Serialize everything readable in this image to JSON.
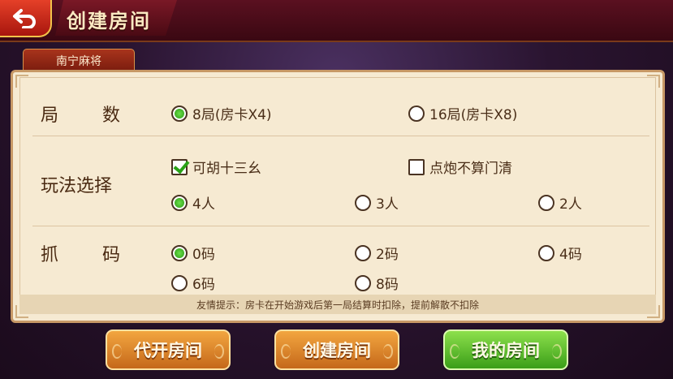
{
  "header": {
    "title": "创建房间"
  },
  "tab": {
    "label": "南宁麻将"
  },
  "rounds": {
    "label": "局数",
    "options": [
      {
        "label": "8局(房卡X4)",
        "selected": true
      },
      {
        "label": "16局(房卡X8)",
        "selected": false
      }
    ]
  },
  "rules": {
    "label": "玩法选择",
    "checkboxes": [
      {
        "label": "可胡十三幺",
        "checked": true
      },
      {
        "label": "点炮不算门清",
        "checked": false
      }
    ],
    "players": [
      {
        "label": "4人",
        "selected": true
      },
      {
        "label": "3人",
        "selected": false
      },
      {
        "label": "2人",
        "selected": false
      }
    ]
  },
  "ma": {
    "label": "抓码",
    "options": [
      {
        "label": "0码",
        "selected": true
      },
      {
        "label": "2码",
        "selected": false
      },
      {
        "label": "4码",
        "selected": false
      },
      {
        "label": "6码",
        "selected": false
      },
      {
        "label": "8码",
        "selected": false
      }
    ]
  },
  "tip": "友情提示：房卡在开始游戏后第一局结算时扣除，提前解散不扣除",
  "buttons": {
    "proxy_open": "代开房间",
    "create": "创建房间",
    "my_rooms": "我的房间"
  },
  "colors": {
    "accent_green": "#3a9e18",
    "accent_orange": "#c5681a",
    "panel_bg": "#f6ead2"
  }
}
